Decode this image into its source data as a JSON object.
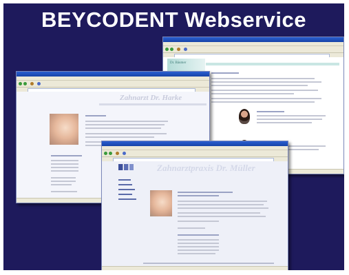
{
  "headline": "BEYCODENT Webservice",
  "windows": {
    "left": {
      "watermark": "Zahnarzt Dr. Harke"
    },
    "right": {
      "logo_text": "Dr. Bäumer"
    },
    "front": {
      "watermark": "Zahnarztpraxis Dr. Müller"
    }
  },
  "colors": {
    "background": "#1e1a5c",
    "titlebar": "#2a5fd0",
    "chrome": "#ece9d8",
    "teal_accent": "#c9e6e3"
  },
  "icons": [
    "browser-window",
    "back-icon",
    "forward-icon",
    "home-icon",
    "search-icon",
    "photo",
    "portrait"
  ]
}
